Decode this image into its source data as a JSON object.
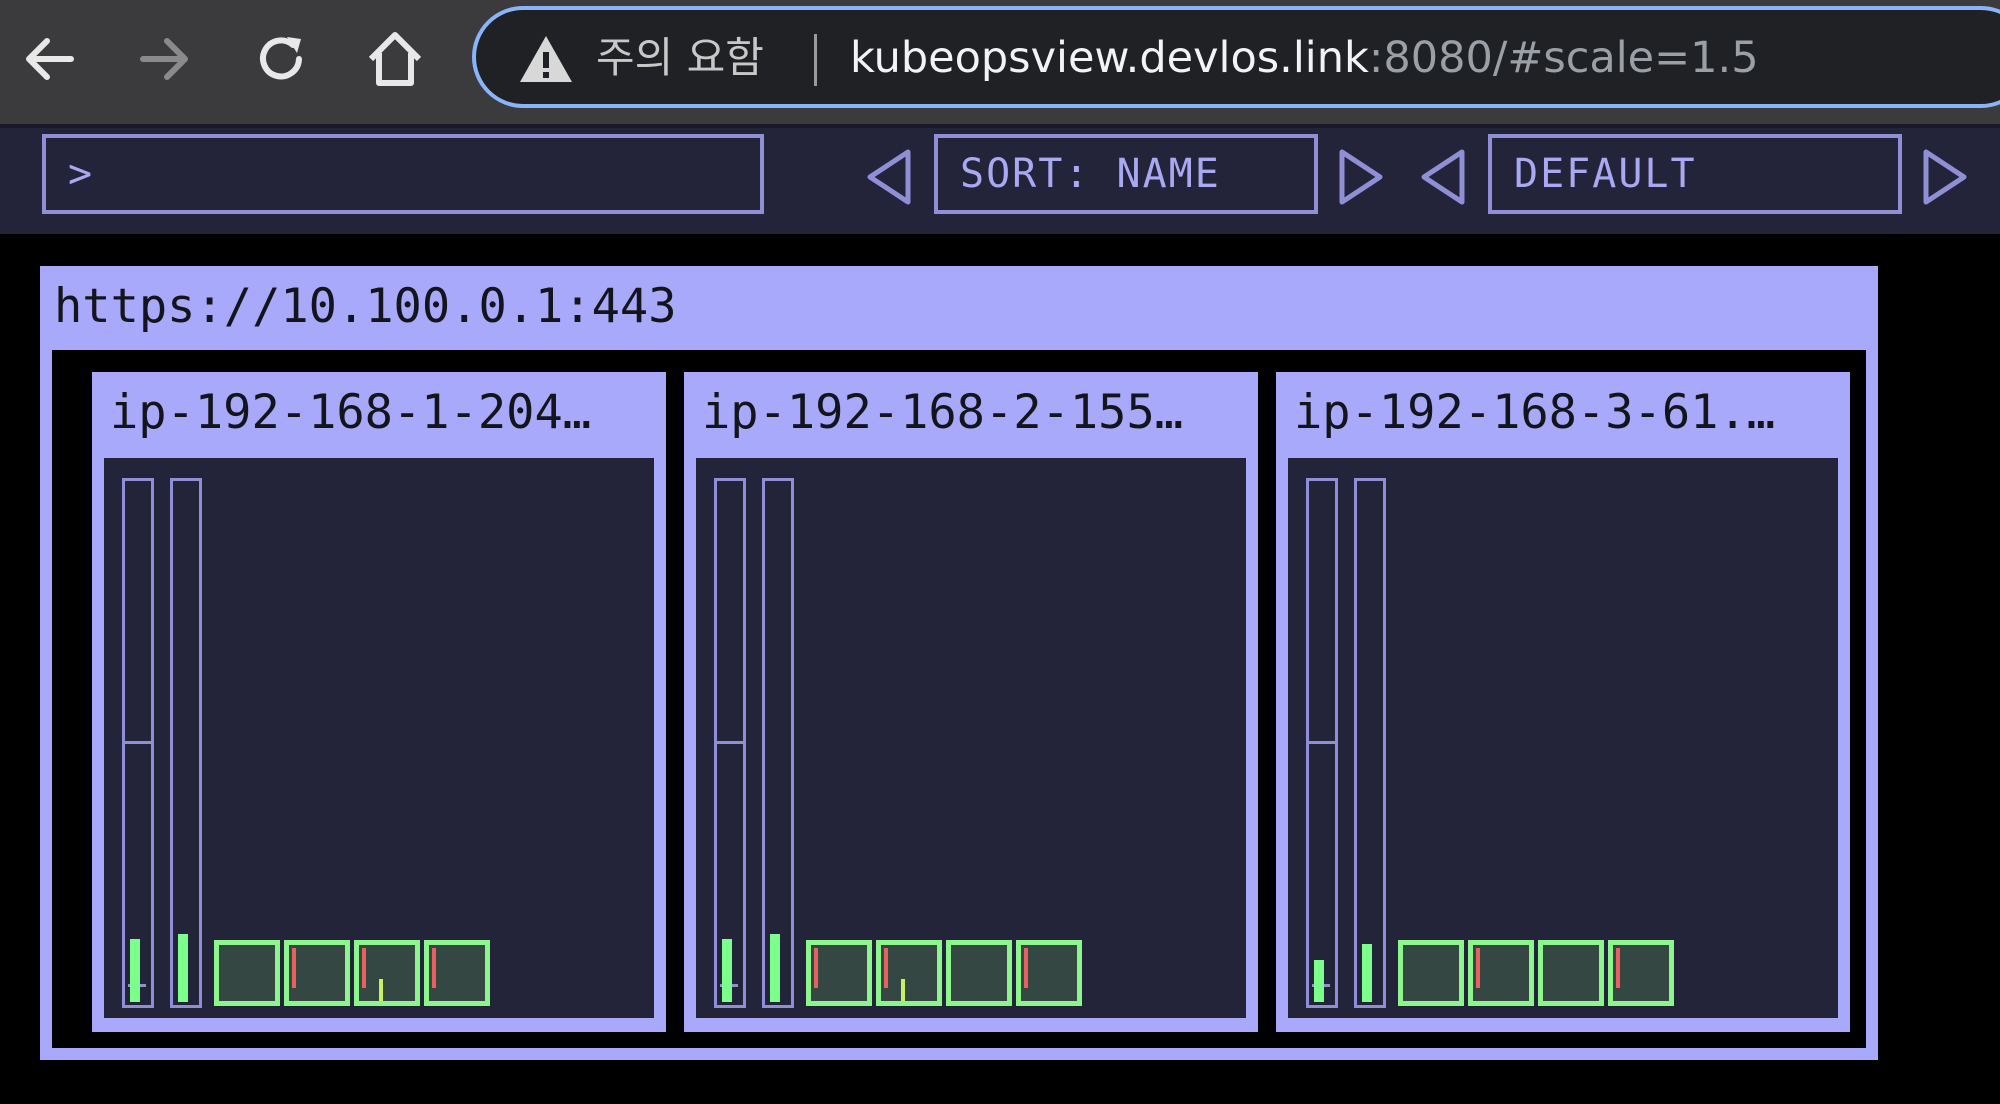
{
  "browser": {
    "warning_text": "주의 요함",
    "url_host": "kubeopsview.devlos.link",
    "url_rest": ":8080/#scale=1.5",
    "icons": [
      "back-arrow-icon",
      "forward-arrow-icon",
      "reload-icon",
      "home-icon",
      "warning-triangle-icon"
    ]
  },
  "toolbar": {
    "filter_value": ">",
    "sort_label": "SORT: NAME",
    "group_label": "DEFAULT"
  },
  "cluster": {
    "title": "https://10.100.0.1:443",
    "nodes": [
      {
        "name": "ip-192-168-1-204…",
        "cpu_usage": 0.12,
        "memory_usage": 0.13,
        "pods": [
          {
            "red": false,
            "yellow": false
          },
          {
            "red": true,
            "yellow": false
          },
          {
            "red": true,
            "yellow": true
          },
          {
            "red": true,
            "yellow": false
          }
        ]
      },
      {
        "name": "ip-192-168-2-155…",
        "cpu_usage": 0.12,
        "memory_usage": 0.13,
        "pods": [
          {
            "red": true,
            "yellow": false
          },
          {
            "red": true,
            "yellow": true
          },
          {
            "red": false,
            "yellow": false
          },
          {
            "red": true,
            "yellow": false
          }
        ]
      },
      {
        "name": "ip-192-168-3-61.…",
        "cpu_usage": 0.08,
        "memory_usage": 0.11,
        "pods": [
          {
            "red": false,
            "yellow": false
          },
          {
            "red": true,
            "yellow": false
          },
          {
            "red": false,
            "yellow": false
          },
          {
            "red": true,
            "yellow": false
          }
        ]
      }
    ]
  },
  "colors": {
    "accent": "#a9a9fb",
    "pod_border": "#8cf58c",
    "usage_fill": "#7cff8a",
    "error_marker": "#e86060"
  }
}
